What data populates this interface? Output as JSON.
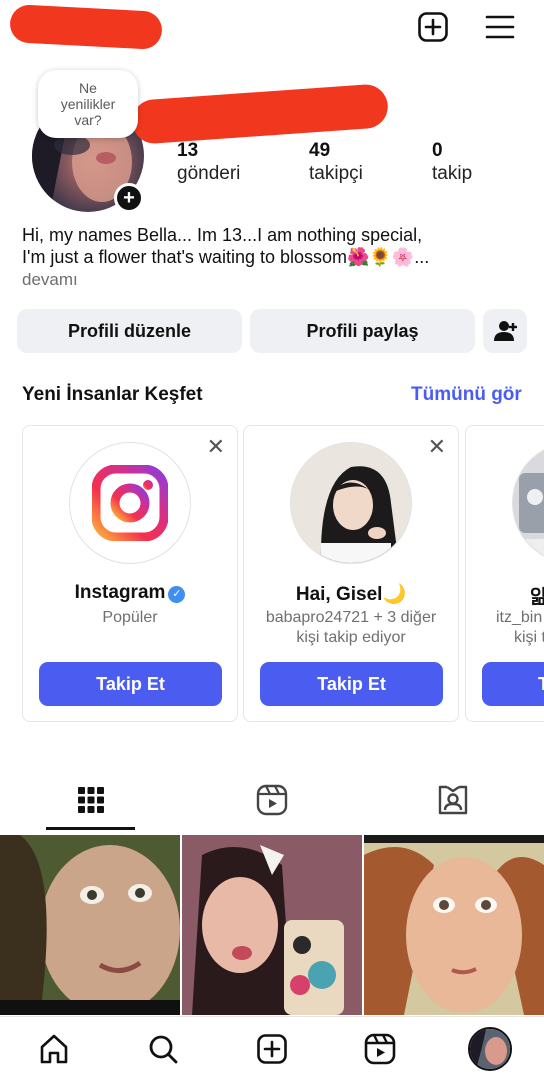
{
  "header": {
    "new_post_icon": "plus-square-icon",
    "menu_icon": "hamburger-menu-icon"
  },
  "profile": {
    "note_bubble": "Ne yenilikler var?",
    "stats": [
      {
        "value": "13",
        "label": "gönderi"
      },
      {
        "value": "49",
        "label": "takipçi"
      },
      {
        "value": "0",
        "label": "takip"
      }
    ],
    "bio_line1": "Hi, my names Bella... Im 13...I am nothing special,",
    "bio_line2": "I'm just a flower that's waiting to blossom🌺🌻🌸...",
    "bio_more": "devamı"
  },
  "actions": {
    "edit_profile": "Profili düzenle",
    "share_profile": "Profili paylaş",
    "add_person_icon": "add-person-icon"
  },
  "discover": {
    "title": "Yeni İnsanlar Keşfet",
    "see_all": "Tümünü gör",
    "cards": [
      {
        "name": "Instagram",
        "sub1": "Popüler",
        "sub2": "",
        "follow": "Takip Et",
        "verified": true
      },
      {
        "name": "Hai, Gisel🌙",
        "sub1": "babapro24721 + 3 diğer",
        "sub2": "kişi takip ediyor",
        "follow": "Takip Et",
        "verified": false
      },
      {
        "name": "앎",
        "sub1": "itz_bin",
        "sub2": "kişi t",
        "follow": "T",
        "verified": false
      }
    ]
  },
  "tabs": [
    {
      "icon": "grid-icon",
      "active": true
    },
    {
      "icon": "reels-icon",
      "active": false
    },
    {
      "icon": "tagged-icon",
      "active": false
    }
  ],
  "bottom_nav": [
    {
      "icon": "home-icon"
    },
    {
      "icon": "search-icon"
    },
    {
      "icon": "create-icon"
    },
    {
      "icon": "reels-icon"
    },
    {
      "icon": "profile-avatar-icon"
    }
  ],
  "colors": {
    "accent": "#4a5df0",
    "redaction": "#f2371f",
    "button_bg": "#eef0f3",
    "verified": "#3f8ef4"
  }
}
